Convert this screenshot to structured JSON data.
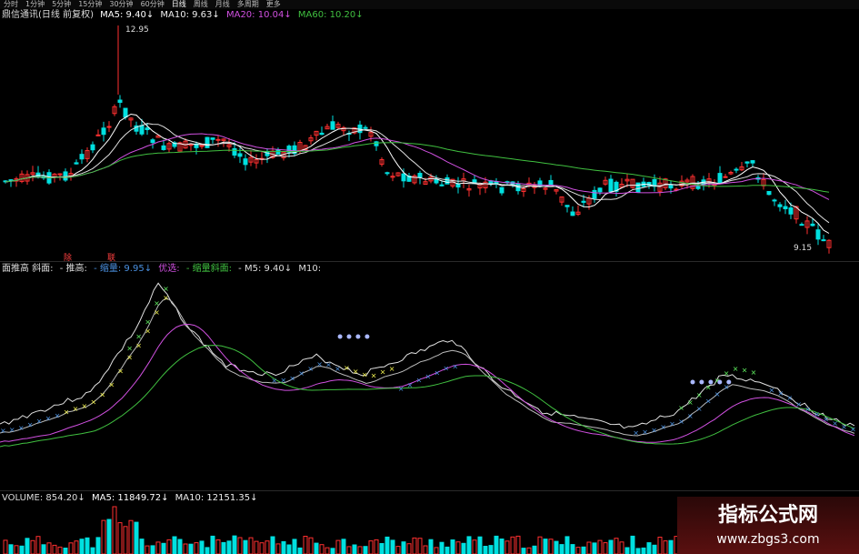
{
  "toolbar": {
    "items": [
      "分时",
      "1分钟",
      "5分钟",
      "15分钟",
      "30分钟",
      "60分钟",
      "日线",
      "周线",
      "月线",
      "多周期",
      "更多"
    ],
    "active": "日线"
  },
  "price_panel": {
    "stock": "鼎信通讯(日线 前复权)",
    "ma5": "MA5: 9.40↓",
    "ma10": "MA10: 9.63↓",
    "ma20": "MA20: 10.04↓",
    "ma60": "MA60: 10.20↓",
    "high_label": "12.95",
    "low_label": "9.15",
    "marker": "除",
    "marker2": "联"
  },
  "indicator_panel": {
    "title": "面推高 斜面:",
    "t1": "- 推高:",
    "t2": "- 缩量: 9.95↓",
    "t3": "优选:",
    "t4": "- 缩量斜面:",
    "t5": "- M5: 9.40↓",
    "t6": "M10:"
  },
  "volume_panel": {
    "volume": "VOLUME: 854.20↓",
    "ma5": "MA5: 11849.72↓",
    "ma10": "MA10: 12151.35↓"
  },
  "watermark": {
    "line1": "指标公式网",
    "line2": "www.zbgs3.com"
  },
  "colors": {
    "up": "#ff3030",
    "down": "#00e0e0",
    "ma5": "#ffffff",
    "ma10": "#e0e0e0",
    "ma20": "#d050e0",
    "ma60": "#40c040"
  }
}
